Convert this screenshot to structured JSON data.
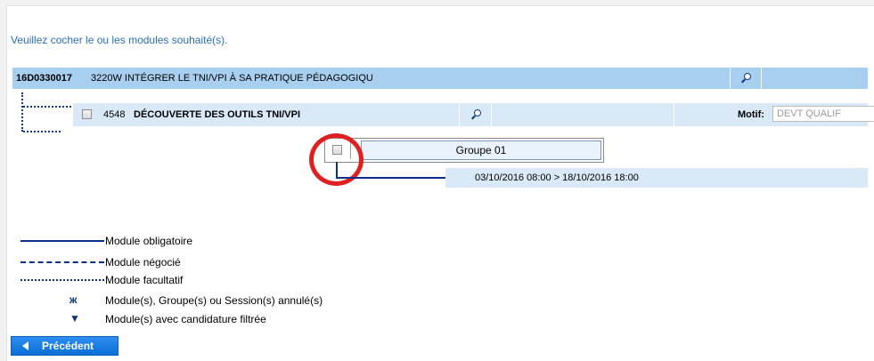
{
  "instruction": "Veuillez cocher le ou les modules souhaité(s).",
  "formation": {
    "code": "16D0330017",
    "title": "3220W INTÉGRER LE TNI/VPI À SA PRATIQUE PÉDAGOGIQU",
    "search_icon": "search-icon"
  },
  "module": {
    "number": "4548",
    "title": "DÉCOUVERTE DES OUTILS TNI/VPI",
    "checked": false,
    "search_icon": "search-icon",
    "motif_label": "Motif:",
    "motif_value": "DEVT QUALIF"
  },
  "group": {
    "label": "Groupe 01",
    "checked": false
  },
  "session": {
    "dates": "03/10/2016 08:00 > 18/10/2016 18:00"
  },
  "legend": [
    {
      "label": "Module obligatoire",
      "style": "solid"
    },
    {
      "label": "Module négocié",
      "style": "dashed"
    },
    {
      "label": "Module facultatif",
      "style": "dotted"
    },
    {
      "label": "Module(s), Groupe(s) ou Session(s) annulé(s)",
      "icon": "cancel-icon"
    },
    {
      "label": "Module(s) avec candidature filtrée",
      "icon": "filter-icon"
    }
  ],
  "buttons": {
    "previous": "Précédent"
  },
  "colors": {
    "accent": "#1a7ee0",
    "header_bar": "#a9cff0",
    "row_bar": "#d9e9f8",
    "highlight_circle": "#e02020",
    "link_text": "#2a6fb7"
  }
}
